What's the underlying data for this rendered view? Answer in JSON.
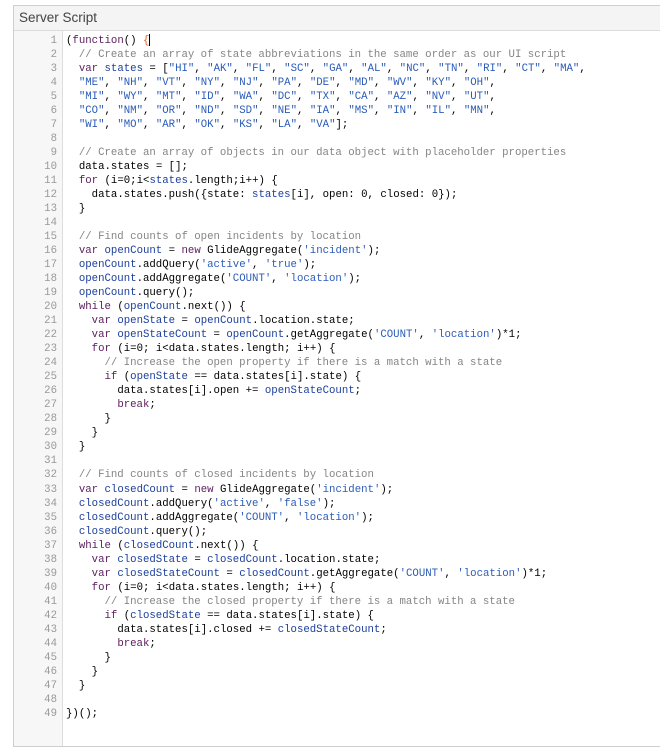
{
  "panel": {
    "title": "Server Script"
  },
  "colors": {
    "keyword": "#5e2160",
    "variable": "#1c3f9c",
    "string": "#2c5cb8",
    "comment": "#858585",
    "matching_bracket": "#e25d2b"
  },
  "code_lines": [
    "(function() {",
    "  // Create an array of state abbreviations in the same order as our UI script",
    "  var states = [\"HI\", \"AK\", \"FL\", \"SC\", \"GA\", \"AL\", \"NC\", \"TN\", \"RI\", \"CT\", \"MA\",",
    "  \"ME\", \"NH\", \"VT\", \"NY\", \"NJ\", \"PA\", \"DE\", \"MD\", \"WV\", \"KY\", \"OH\",",
    "  \"MI\", \"WY\", \"MT\", \"ID\", \"WA\", \"DC\", \"TX\", \"CA\", \"AZ\", \"NV\", \"UT\",",
    "  \"CO\", \"NM\", \"OR\", \"ND\", \"SD\", \"NE\", \"IA\", \"MS\", \"IN\", \"IL\", \"MN\",",
    "  \"WI\", \"MO\", \"AR\", \"OK\", \"KS\", \"LA\", \"VA\"];",
    "",
    "  // Create an array of objects in our data object with placeholder properties",
    "  data.states = [];",
    "  for (i=0;i<states.length;i++) {",
    "    data.states.push({state: states[i], open: 0, closed: 0});",
    "  }",
    "",
    "  // Find counts of open incidents by location",
    "  var openCount = new GlideAggregate('incident');",
    "  openCount.addQuery('active', 'true');",
    "  openCount.addAggregate('COUNT', 'location');",
    "  openCount.query();",
    "  while (openCount.next()) {",
    "    var openState = openCount.location.state;",
    "    var openStateCount = openCount.getAggregate('COUNT', 'location')*1;",
    "    for (i=0; i<data.states.length; i++) {",
    "      // Increase the open property if there is a match with a state",
    "      if (openState == data.states[i].state) {",
    "        data.states[i].open += openStateCount;",
    "        break;",
    "      }",
    "    }",
    "  }",
    "",
    "  // Find counts of closed incidents by location",
    "  var closedCount = new GlideAggregate('incident');",
    "  closedCount.addQuery('active', 'false');",
    "  closedCount.addAggregate('COUNT', 'location');",
    "  closedCount.query();",
    "  while (closedCount.next()) {",
    "    var closedState = closedCount.location.state;",
    "    var closedStateCount = closedCount.getAggregate('COUNT', 'location')*1;",
    "    for (i=0; i<data.states.length; i++) {",
    "      // Increase the closed property if there is a match with a state",
    "      if (closedState == data.states[i].state) {",
    "        data.states[i].closed += closedStateCount;",
    "        break;",
    "      }",
    "    }",
    "  }",
    "",
    "})();"
  ]
}
